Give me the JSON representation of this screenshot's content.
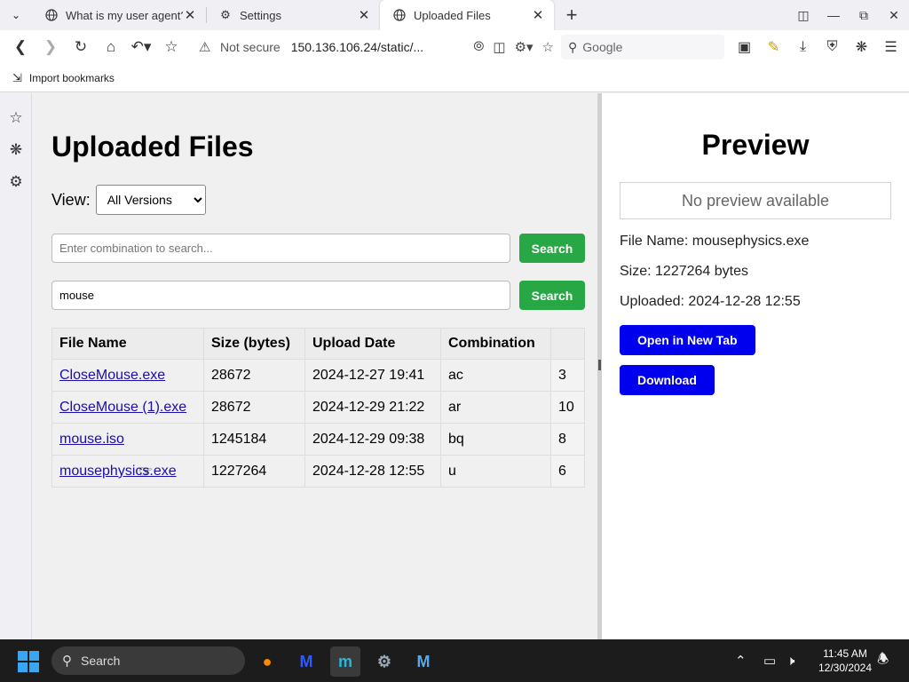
{
  "browser": {
    "tabs": [
      {
        "label": "What is my user agent?",
        "icon": "globe-icon",
        "active": false
      },
      {
        "label": "Settings",
        "icon": "gear-icon",
        "active": false
      },
      {
        "label": "Uploaded Files",
        "icon": "globe-icon",
        "active": true
      }
    ],
    "address": {
      "security_text": "Not secure",
      "url": "150.136.106.24/static/..."
    },
    "search_placeholder": "Google",
    "bookmarks": [
      {
        "label": "Import bookmarks",
        "icon": "import-icon"
      }
    ]
  },
  "page": {
    "title": "Uploaded Files",
    "view_label": "View:",
    "view_selected": "All Versions",
    "search1": {
      "placeholder": "Enter combination to search...",
      "value": "",
      "button": "Search"
    },
    "search2": {
      "placeholder": "",
      "value": "mouse",
      "button": "Search"
    },
    "table": {
      "headers": [
        "File Name",
        "Size (bytes)",
        "Upload Date",
        "Combination"
      ],
      "rows": [
        {
          "name": "CloseMouse.exe",
          "size": "28672",
          "date": "2024-12-27 19:41",
          "combination": "ac",
          "extra": "3"
        },
        {
          "name": "CloseMouse (1).exe",
          "size": "28672",
          "date": "2024-12-29 21:22",
          "combination": "ar",
          "extra": "10"
        },
        {
          "name": "mouse.iso",
          "size": "1245184",
          "date": "2024-12-29 09:38",
          "combination": "bq",
          "extra": "8"
        },
        {
          "name": "mousephysics.exe",
          "size": "1227264",
          "date": "2024-12-28 12:55",
          "combination": "u",
          "extra": "6"
        }
      ]
    }
  },
  "preview": {
    "title": "Preview",
    "no_preview": "No preview available",
    "file_name": "File Name: mousephysics.exe",
    "size": "Size: 1227264 bytes",
    "uploaded": "Uploaded: 2024-12-28 12:55",
    "open_button": "Open in New Tab",
    "download_button": "Download"
  },
  "taskbar": {
    "search_label": "Search",
    "time": "11:45 AM",
    "date": "12/30/2024"
  },
  "colors": {
    "search_button": "#28a745",
    "preview_button": "#0000ee",
    "link": "#1a0dab"
  }
}
